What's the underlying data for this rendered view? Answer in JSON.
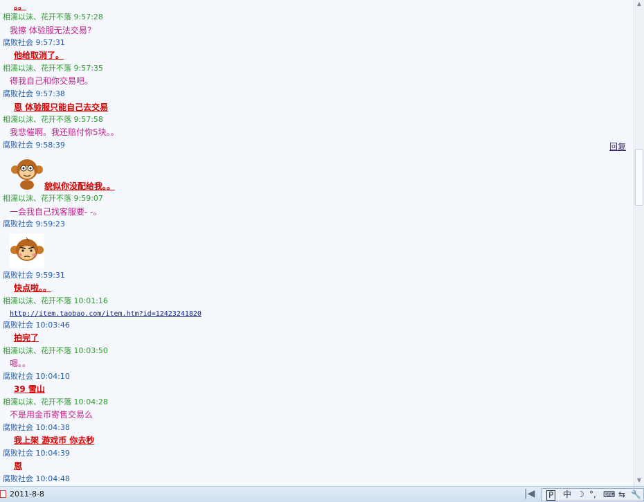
{
  "messages": [
    {
      "type": "body",
      "sender": "self",
      "text": "。。"
    },
    {
      "type": "header",
      "sender": "peer",
      "name": "相濡以沫、花开不落",
      "time": "9:57:28"
    },
    {
      "type": "body",
      "sender": "peer",
      "text": "我擦 体验服无法交易？"
    },
    {
      "type": "header",
      "sender": "self",
      "name": "腐败社会",
      "time": "9:57:31"
    },
    {
      "type": "body",
      "sender": "self",
      "text": "他给取消了。"
    },
    {
      "type": "header",
      "sender": "peer",
      "name": "相濡以沫、花开不落",
      "time": "9:57:35"
    },
    {
      "type": "body",
      "sender": "peer",
      "text": "得我自己和你交易吧。"
    },
    {
      "type": "header",
      "sender": "self",
      "name": "腐败社会",
      "time": "9:57:38"
    },
    {
      "type": "body",
      "sender": "self",
      "text": "恩 体验服只能自己去交易"
    },
    {
      "type": "header",
      "sender": "peer",
      "name": "相濡以沫、花开不落",
      "time": "9:57:58"
    },
    {
      "type": "body",
      "sender": "peer",
      "text": "我悲催啊。我还赔付你5块。。"
    },
    {
      "type": "header",
      "sender": "self",
      "name": "腐败社会",
      "time": "9:58:39",
      "reply": "回复"
    },
    {
      "type": "body",
      "sender": "self",
      "text": "貌似你没配给我。。"
    },
    {
      "type": "header",
      "sender": "peer",
      "name": "相濡以沫、花开不落",
      "time": "9:59:07"
    },
    {
      "type": "body",
      "sender": "peer",
      "text": "一会我自己找客服要- -。"
    },
    {
      "type": "header",
      "sender": "self",
      "name": "腐败社会",
      "time": "9:59:23"
    },
    {
      "type": "header",
      "sender": "self",
      "name": "腐败社会",
      "time": "9:59:31"
    },
    {
      "type": "body",
      "sender": "self",
      "text": "快点啦。。"
    },
    {
      "type": "header",
      "sender": "peer",
      "name": "相濡以沫、花开不落",
      "time": "10:01:16"
    },
    {
      "type": "body",
      "sender": "link",
      "text": "http://item.taobao.com/item.htm?id=12423241820"
    },
    {
      "type": "header",
      "sender": "self",
      "name": "腐败社会",
      "time": "10:03:46"
    },
    {
      "type": "body",
      "sender": "self",
      "text": "拍完了"
    },
    {
      "type": "header",
      "sender": "peer",
      "name": "相濡以沫、花开不落",
      "time": "10:03:50"
    },
    {
      "type": "body",
      "sender": "peer",
      "text": "嗯。。"
    },
    {
      "type": "header",
      "sender": "self",
      "name": "腐败社会",
      "time": "10:04:10"
    },
    {
      "type": "body",
      "sender": "self",
      "text": "39 雪山"
    },
    {
      "type": "header",
      "sender": "peer",
      "name": "相濡以沫、花开不落",
      "time": "10:04:28"
    },
    {
      "type": "body",
      "sender": "peer",
      "text": "不是用金币寄售交易么"
    },
    {
      "type": "header",
      "sender": "self",
      "name": "腐败社会",
      "time": "10:04:38"
    },
    {
      "type": "body",
      "sender": "self",
      "text": "我上架 游戏币 你去秒"
    },
    {
      "type": "header",
      "sender": "self",
      "name": "腐败社会",
      "time": "10:04:39"
    },
    {
      "type": "body",
      "sender": "self",
      "text": "恩"
    },
    {
      "type": "header",
      "sender": "self",
      "name": "腐败社会",
      "time": "10:04:48"
    }
  ],
  "emoticons": [
    "monkey-emoticon",
    "monkey-blush-emoticon"
  ],
  "statusbar": {
    "date": "2011-8-8",
    "ime": {
      "mode": "中",
      "moon": "☽",
      "punct": "°,",
      "keyboard": "⌨",
      "ime_icon": "⇆",
      "tools": "🔧"
    }
  }
}
